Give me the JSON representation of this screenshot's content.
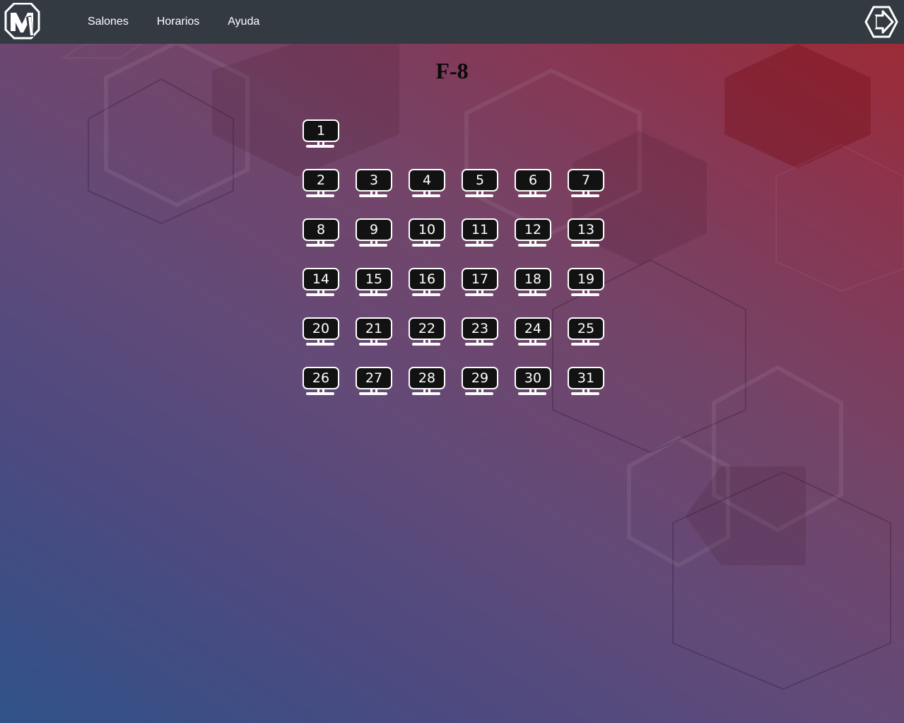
{
  "nav": {
    "logo_icon": "m-logo-icon",
    "links": [
      "Salones",
      "Horarios",
      "Ayuda"
    ],
    "logout_icon": "logout-arrow-icon"
  },
  "room": {
    "title": "F-8"
  },
  "computers": {
    "row1": [
      "1"
    ],
    "row2": [
      "2",
      "3",
      "4",
      "5",
      "6",
      "7"
    ],
    "row3": [
      "8",
      "9",
      "10",
      "11",
      "12",
      "13"
    ],
    "row4": [
      "14",
      "15",
      "16",
      "17",
      "18",
      "19"
    ],
    "row5": [
      "20",
      "21",
      "22",
      "23",
      "24",
      "25"
    ],
    "row6": [
      "26",
      "27",
      "28",
      "29",
      "30",
      "31"
    ]
  },
  "colors": {
    "navbar": "#343a42",
    "monitor": "#121212",
    "gradient_start": "#2f5288",
    "gradient_end": "#a02830"
  }
}
